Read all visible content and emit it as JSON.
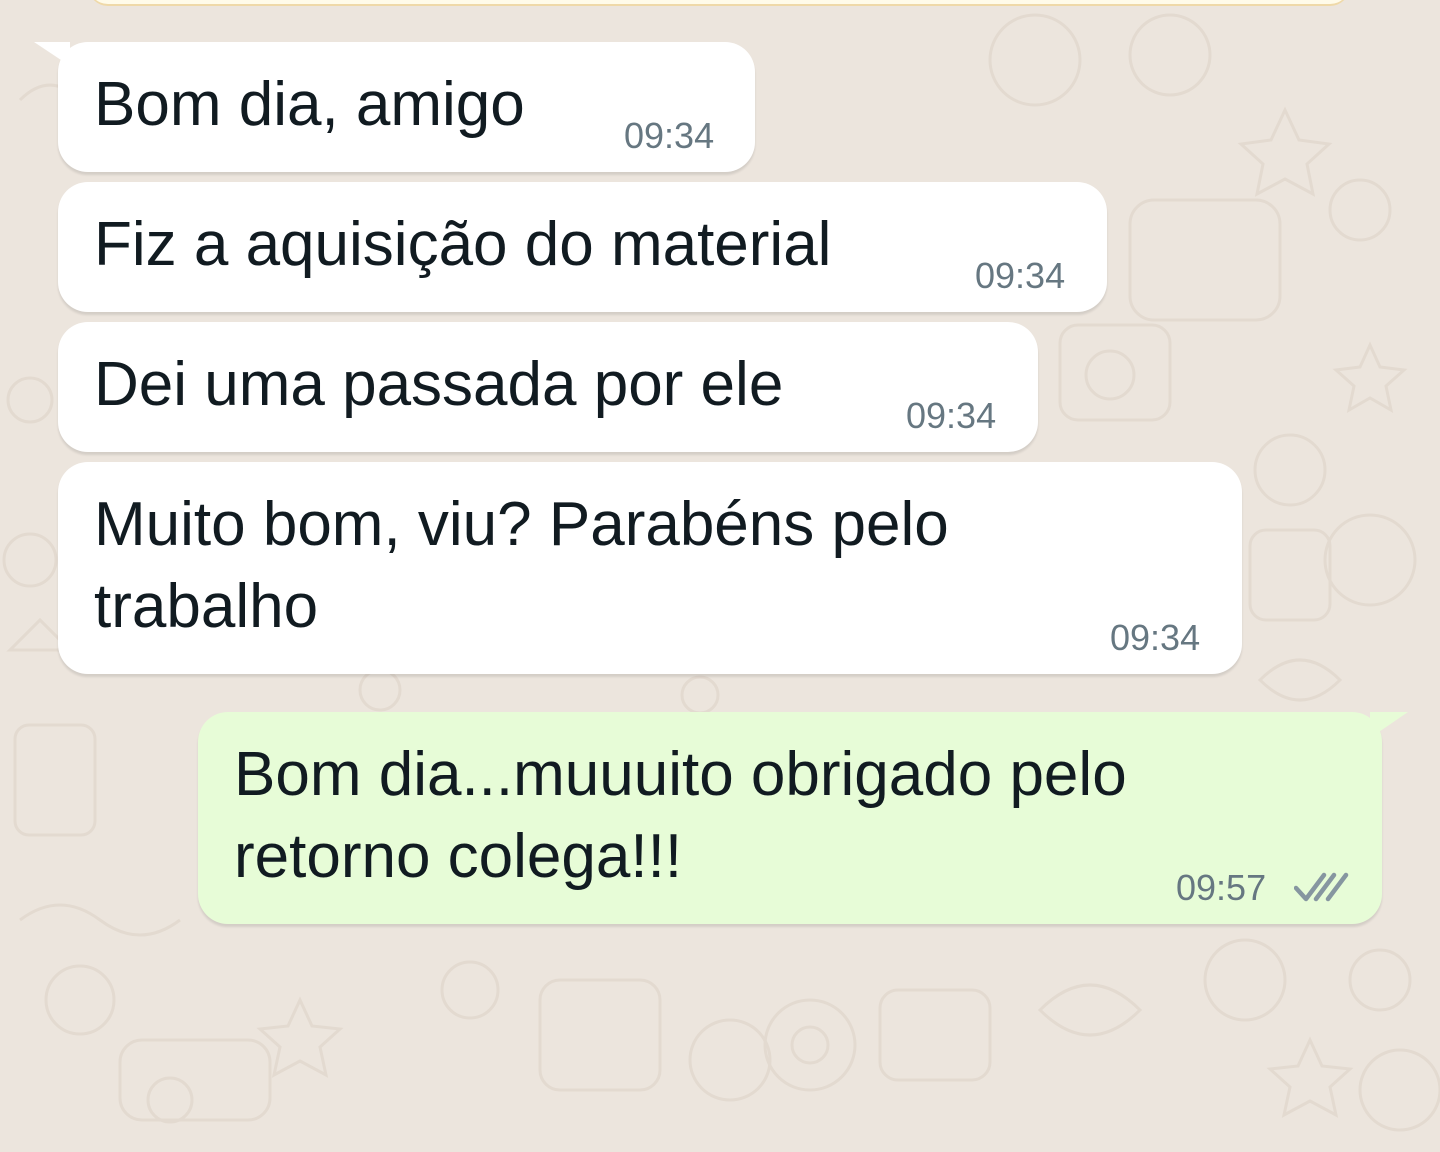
{
  "chat": {
    "messages": [
      {
        "direction": "incoming",
        "text": "Bom dia, amigo",
        "time": "09:34"
      },
      {
        "direction": "incoming",
        "text": "Fiz a aquisição do material",
        "time": "09:34"
      },
      {
        "direction": "incoming",
        "text": "Dei uma passada por ele",
        "time": "09:34"
      },
      {
        "direction": "incoming",
        "lines": [
          "Muito bom, viu? Parabéns pelo",
          "trabalho"
        ],
        "time": "09:34"
      },
      {
        "direction": "outgoing",
        "lines": [
          "Bom dia...muuuito obrigado pelo",
          "retorno colega!!!"
        ],
        "time": "09:57",
        "status_icon": "double-check-icon"
      }
    ]
  },
  "theme": {
    "background": "#ece5dd",
    "incoming_bubble": "#ffffff",
    "outgoing_bubble": "#e7fcd7",
    "text": "#111b21",
    "time_text": "#667781",
    "tick_color": "#8696a0"
  }
}
